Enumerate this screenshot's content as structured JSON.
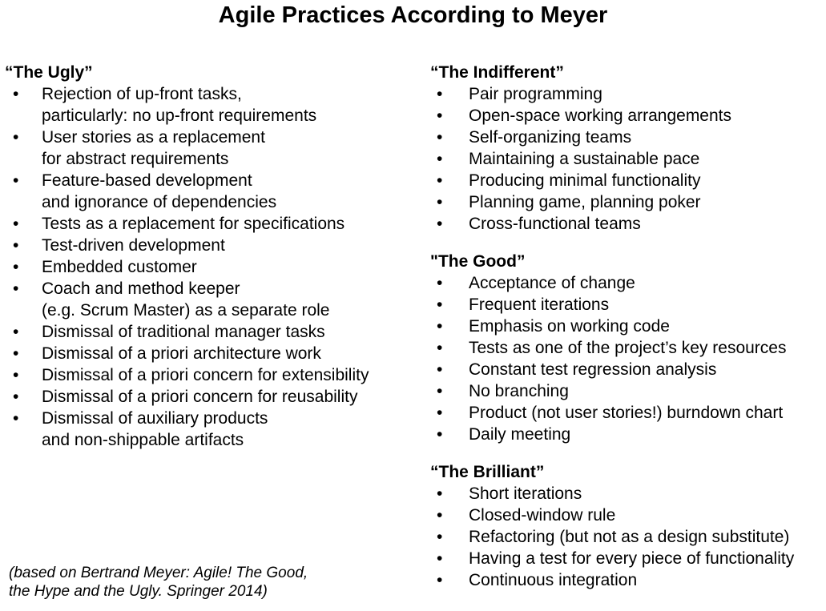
{
  "title": "Agile Practices According to Meyer",
  "left_column": {
    "sections": [
      {
        "heading": "“The Ugly”",
        "items": [
          [
            "Rejection of up-front tasks,",
            "particularly: no up-front requirements"
          ],
          [
            "User stories as a replacement",
            "for abstract requirements"
          ],
          [
            "Feature-based development",
            "and ignorance of dependencies"
          ],
          [
            "Tests as a replacement for specifications"
          ],
          [
            "Test-driven development"
          ],
          [
            "Embedded customer"
          ],
          [
            "Coach and method keeper",
            "(e.g. Scrum Master) as a separate role"
          ],
          [
            "Dismissal of traditional manager tasks"
          ],
          [
            "Dismissal of a priori architecture work"
          ],
          [
            "Dismissal of a priori concern for extensibility"
          ],
          [
            "Dismissal of a priori concern for reusability"
          ],
          [
            "Dismissal of auxiliary products",
            "and non-shippable artifacts"
          ]
        ]
      }
    ]
  },
  "right_column": {
    "sections": [
      {
        "heading": "“The Indifferent”",
        "items": [
          [
            "Pair programming"
          ],
          [
            "Open-space working arrangements"
          ],
          [
            "Self-organizing teams"
          ],
          [
            "Maintaining a sustainable pace"
          ],
          [
            "Producing minimal functionality"
          ],
          [
            "Planning game, planning poker"
          ],
          [
            "Cross-functional teams"
          ]
        ]
      },
      {
        "heading": "\"The Good”",
        "items": [
          [
            "Acceptance of change"
          ],
          [
            "Frequent iterations"
          ],
          [
            "Emphasis on working code"
          ],
          [
            "Tests as one of the project’s key resources"
          ],
          [
            "Constant test regression analysis"
          ],
          [
            "No branching"
          ],
          [
            "Product (not user stories!) burndown chart"
          ],
          [
            "Daily meeting"
          ]
        ]
      },
      {
        "heading": "“The Brilliant”",
        "items": [
          [
            "Short iterations"
          ],
          [
            "Closed-window rule"
          ],
          [
            "Refactoring (but not as a design substitute)"
          ],
          [
            "Having a test for every piece of functionality"
          ],
          [
            "Continuous integration"
          ]
        ]
      }
    ]
  },
  "citation": {
    "lines": [
      "(based on Bertrand Meyer: Agile! The Good,",
      "the Hype and the Ugly. Springer 2014)"
    ]
  },
  "bullet_glyph": "•"
}
